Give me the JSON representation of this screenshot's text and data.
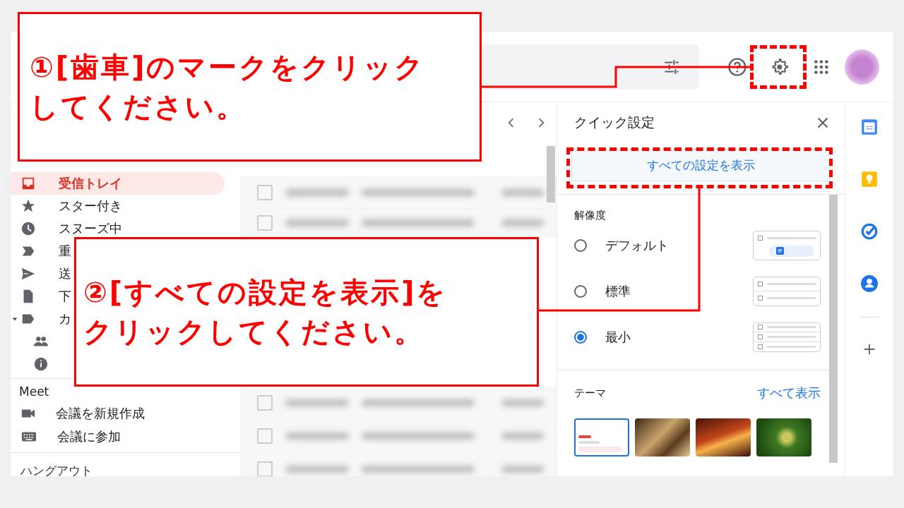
{
  "sidebar": {
    "items": [
      {
        "label": "受信トレイ",
        "kind": "inbox",
        "selected": true
      },
      {
        "label": "スター付き",
        "kind": "star",
        "selected": false
      },
      {
        "label": "スヌーズ中",
        "kind": "clock",
        "selected": false
      },
      {
        "label": "重",
        "kind": "important",
        "selected": false
      },
      {
        "label": "送",
        "kind": "send",
        "selected": false
      },
      {
        "label": "下",
        "kind": "file",
        "selected": false
      },
      {
        "label": "カ",
        "kind": "label",
        "selected": false,
        "expanded": true,
        "children": [
          {
            "kind": "people",
            "selected": false
          },
          {
            "kind": "info",
            "selected": false
          }
        ]
      }
    ],
    "meet": {
      "heading": "Meet",
      "items": [
        {
          "label": "会議を新規作成",
          "kind": "video"
        },
        {
          "label": "会議に参加",
          "kind": "keyboard"
        }
      ]
    },
    "hangouts": "ハングアウト"
  },
  "quick_settings": {
    "title": "クイック設定",
    "all_settings": "すべての設定を表示",
    "density_heading": "解像度",
    "density": [
      {
        "label": "デフォルト",
        "kind": "default",
        "selected": false
      },
      {
        "label": "標準",
        "kind": "comfortable",
        "selected": false
      },
      {
        "label": "最小",
        "kind": "compact",
        "selected": true
      }
    ],
    "theme_heading": "テーマ",
    "theme_link": "すべて表示",
    "themes": [
      {
        "kind": "default",
        "selected": true
      },
      {
        "kind": "chess",
        "selected": false
      },
      {
        "kind": "canyon",
        "selected": false
      },
      {
        "kind": "caterpillar",
        "selected": false
      }
    ]
  },
  "annotations": [
    {
      "lines": [
        "①[歯車]のマークをクリック",
        "してください。"
      ]
    },
    {
      "lines": [
        "②[すべての設定を表示]を",
        "クリックしてください。"
      ]
    }
  ]
}
